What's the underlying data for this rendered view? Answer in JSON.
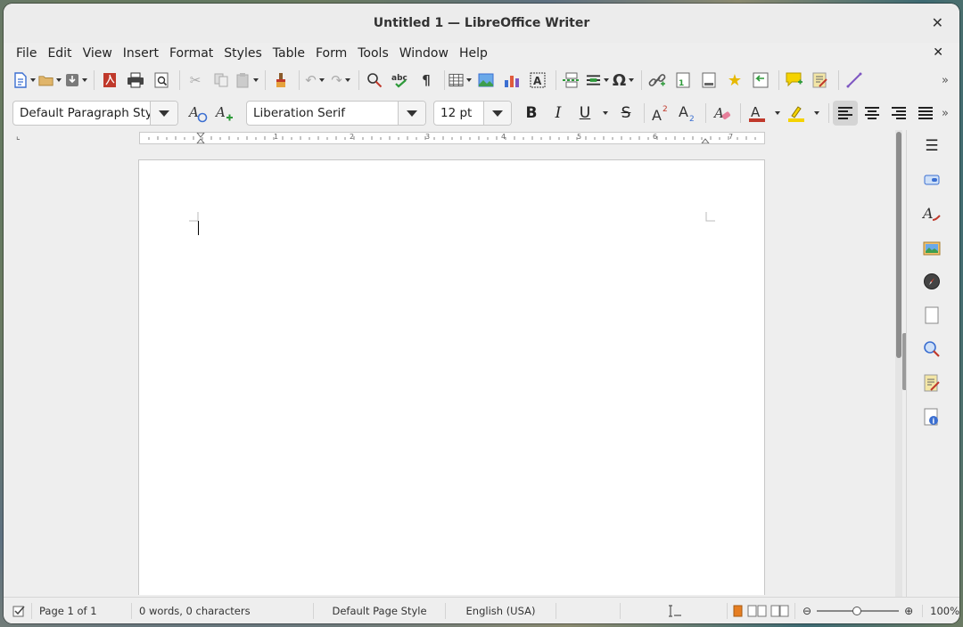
{
  "window": {
    "title": "Untitled 1 — LibreOffice Writer",
    "close_glyph": "✕"
  },
  "menu": [
    {
      "label": "File"
    },
    {
      "label": "Edit"
    },
    {
      "label": "View"
    },
    {
      "label": "Insert"
    },
    {
      "label": "Format"
    },
    {
      "label": "Styles"
    },
    {
      "label": "Table"
    },
    {
      "label": "Form"
    },
    {
      "label": "Tools"
    },
    {
      "label": "Window"
    },
    {
      "label": "Help"
    }
  ],
  "menu_close_glyph": "✕",
  "formatting": {
    "paragraph_style": "Default Paragraph Style",
    "font_name": "Liberation Serif",
    "font_size": "12 pt",
    "bold_label": "B",
    "italic_label": "I",
    "underline_label": "U",
    "strike_label": "S"
  },
  "ruler_numbers": [
    "1",
    "2",
    "3",
    "4",
    "5",
    "6",
    "7"
  ],
  "status": {
    "page": "Page 1 of 1",
    "words": "0 words, 0 characters",
    "page_style": "Default Page Style",
    "language": "English (USA)",
    "zoom": "100%"
  },
  "colors": {
    "accent_red": "#c0392b",
    "highlight_yellow": "#f5d300",
    "chart_blue": "#3b6fd1"
  }
}
